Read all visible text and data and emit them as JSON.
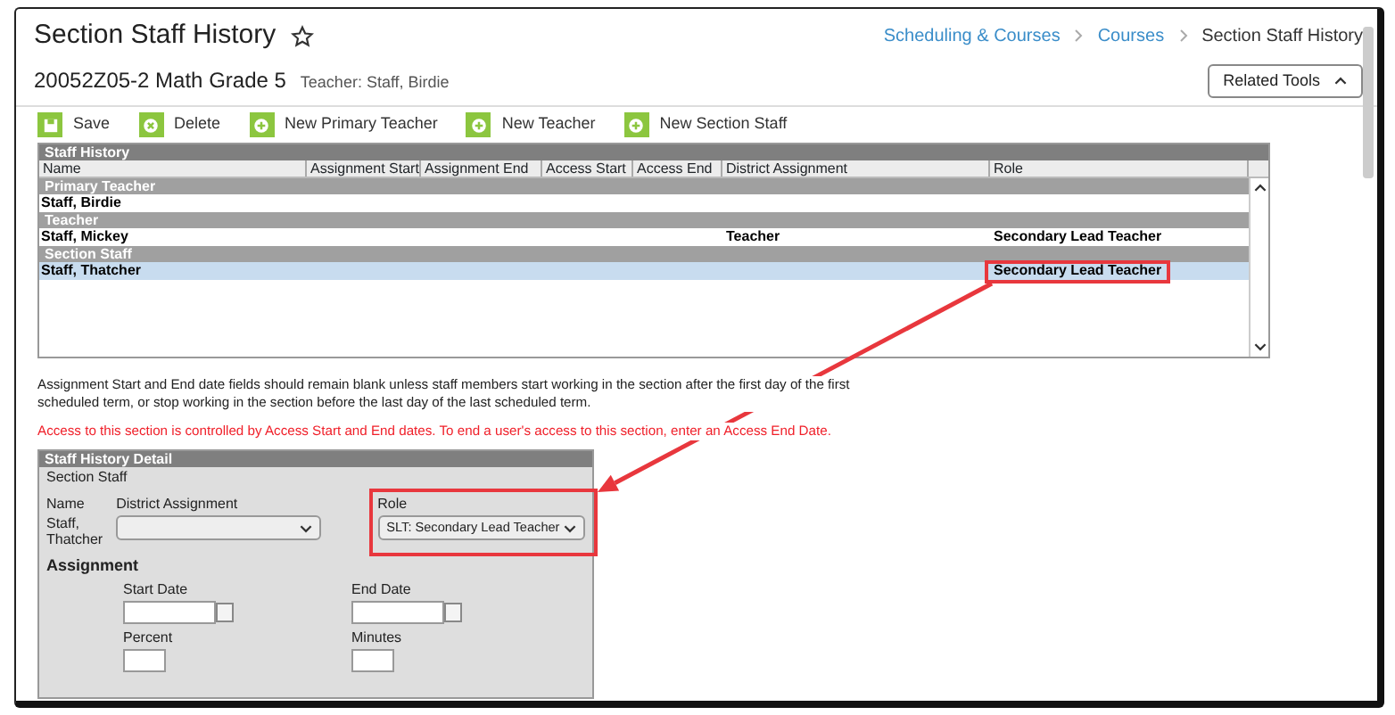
{
  "page": {
    "title": "Section Staff History",
    "subtitle": "20052Z05-2 Math Grade 5",
    "teacher": "Teacher: Staff, Birdie"
  },
  "breadcrumbs": [
    {
      "label": "Scheduling & Courses",
      "link": true
    },
    {
      "label": "Courses",
      "link": true
    },
    {
      "label": "Section Staff History",
      "link": false
    }
  ],
  "related_tools": {
    "label": "Related Tools",
    "expanded": true
  },
  "toolbar": [
    {
      "label": "Save",
      "kind": "save"
    },
    {
      "label": "Delete",
      "kind": "delete"
    },
    {
      "label": "New Primary Teacher",
      "kind": "add"
    },
    {
      "label": "New Teacher",
      "kind": "add"
    },
    {
      "label": "New Section Staff",
      "kind": "add"
    }
  ],
  "staff_history": {
    "title": "Staff History",
    "columns": [
      "Name",
      "Assignment Start",
      "Assignment End",
      "Access Start",
      "Access End",
      "District Assignment",
      "Role"
    ],
    "groups": [
      {
        "label": "Primary Teacher",
        "rows": [
          {
            "name": "Staff, Birdie",
            "selected": false,
            "highlighted": false
          }
        ]
      },
      {
        "label": "Teacher",
        "rows": [
          {
            "name": "Staff, Mickey",
            "district_assignment": "Teacher",
            "role": "Secondary Lead Teacher",
            "selected": false,
            "highlighted": false
          }
        ]
      },
      {
        "label": "Section Staff",
        "rows": [
          {
            "name": "Staff, Thatcher",
            "role": "Secondary Lead Teacher",
            "selected": true,
            "highlighted": true
          }
        ]
      }
    ]
  },
  "notes": [
    {
      "text": "Assignment Start and End date fields should remain blank unless staff members start working in the section after the first day of the first scheduled term, or stop working in the section before the last day of the last scheduled term.",
      "kind": "info"
    },
    {
      "text": "Access to this section is controlled by Access Start and End dates. To end a user's access to this section, enter an Access End Date.",
      "kind": "warning"
    }
  ],
  "detail": {
    "title": "Staff History Detail",
    "section": "Section Staff",
    "name_label": "Name",
    "name_value": "Staff, Thatcher",
    "district_assignment_label": "District Assignment",
    "role_label": "Role",
    "role_value": "SLT: Secondary Lead Teacher",
    "role_highlighted": true,
    "assignment_heading": "Assignment",
    "fields": [
      {
        "label": "Start Date",
        "kind": "date"
      },
      {
        "label": "End Date",
        "kind": "date"
      },
      {
        "label": "Percent",
        "kind": "number"
      },
      {
        "label": "Minutes",
        "kind": "number"
      }
    ]
  }
}
